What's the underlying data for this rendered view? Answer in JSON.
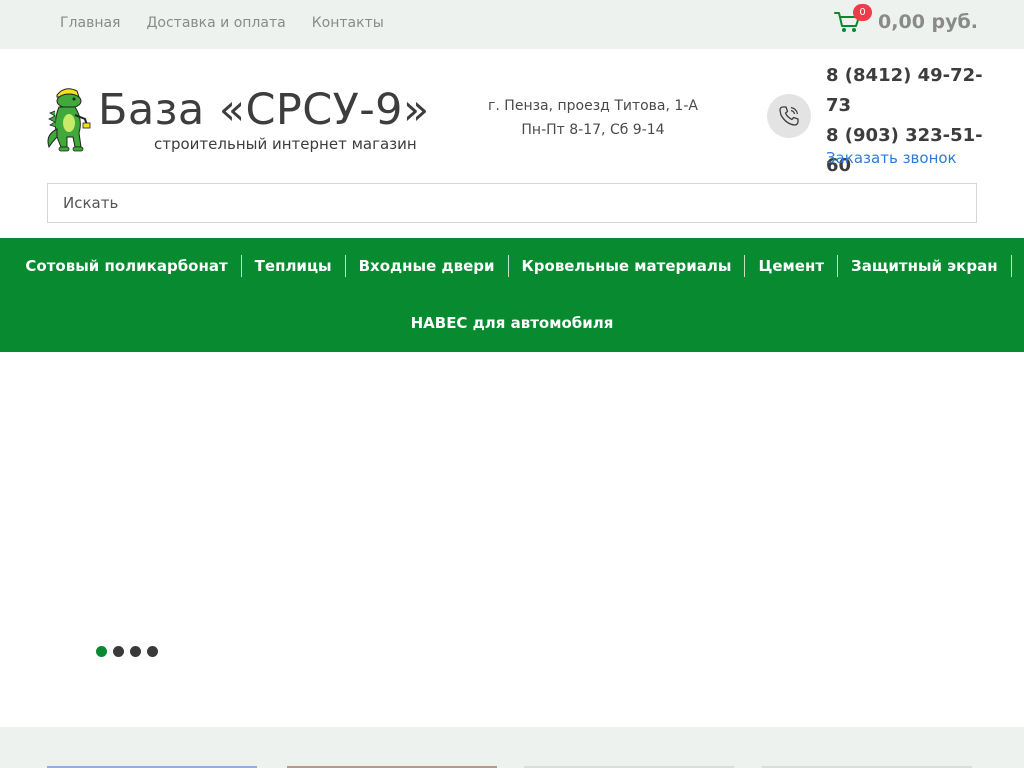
{
  "topnav": {
    "items": [
      {
        "label": "Главная"
      },
      {
        "label": "Доставка и оплата"
      },
      {
        "label": "Контакты"
      }
    ]
  },
  "cart": {
    "count": "0",
    "total": "0,00 руб.",
    "icon": "cart-icon"
  },
  "brand": {
    "title": "База «СРСУ-9»",
    "subtitle": "строительный интернет магазин"
  },
  "address": {
    "line1": "г. Пенза, проезд Титова, 1-А",
    "line2": "Пн-Пт 8-17, Сб 9-14"
  },
  "contacts": {
    "phone1": "8 (8412) 49-72-73",
    "phone2": "8 (903) 323-51-60",
    "callback": "Заказать звонок",
    "icon": "phone-icon"
  },
  "search": {
    "placeholder": "Искать"
  },
  "mainnav": {
    "row1": [
      {
        "label": "Сотовый поликарбонат"
      },
      {
        "label": "Теплицы"
      },
      {
        "label": "Входные двери"
      },
      {
        "label": "Кровельные материалы"
      },
      {
        "label": "Цемент"
      },
      {
        "label": "Защитный экран"
      }
    ],
    "row2": [
      {
        "label": "НАВЕС для автомобиля"
      }
    ]
  },
  "slider": {
    "slide_count": 4,
    "active_index": 0
  },
  "colors": {
    "accent_green": "#078a30",
    "topbar_bg": "#eef2ee",
    "badge_red": "#ef3b4a",
    "link_blue": "#2e7bd6"
  }
}
